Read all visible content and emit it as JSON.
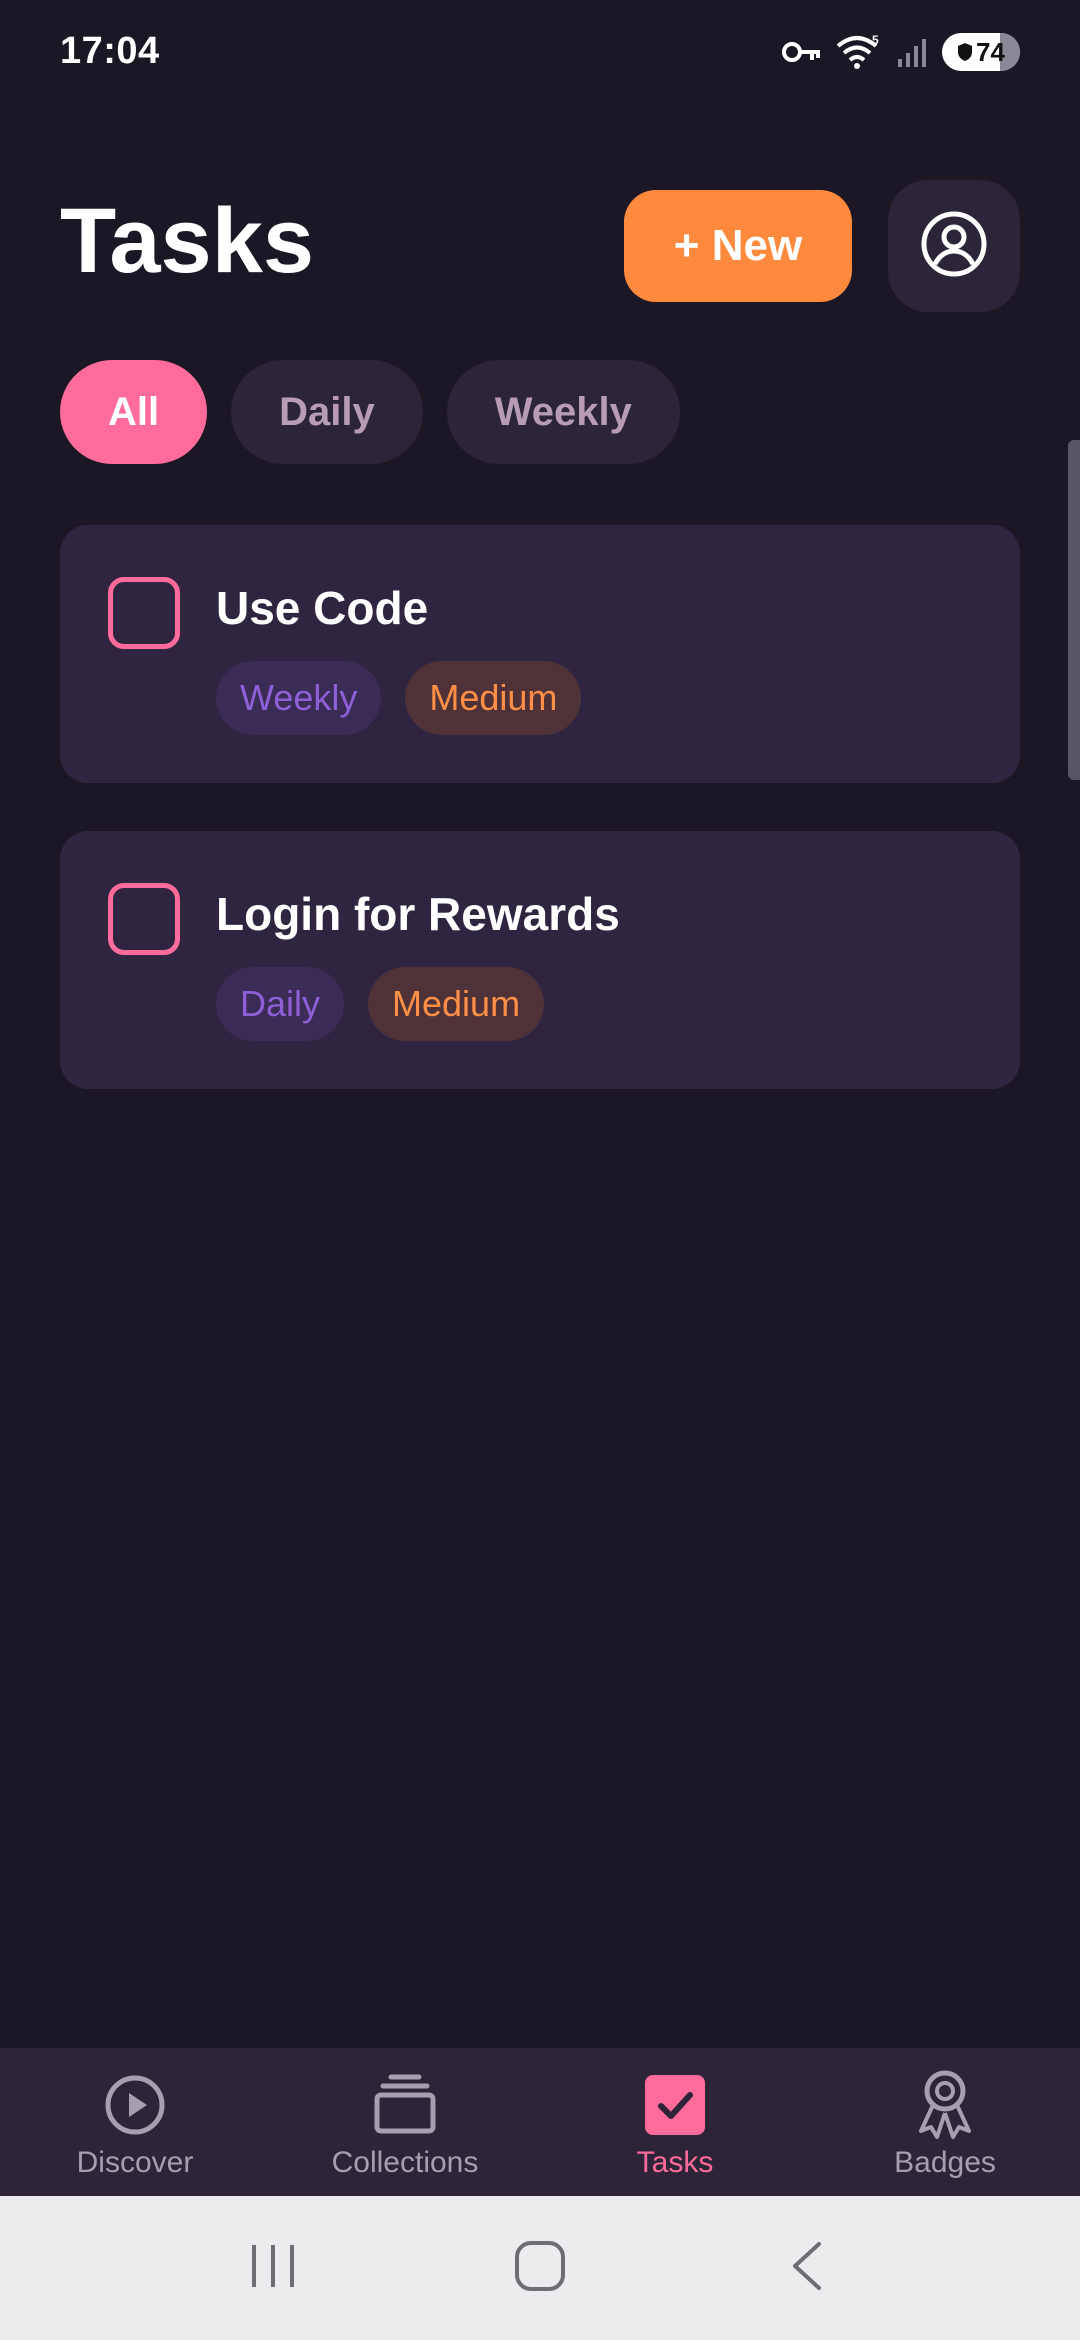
{
  "status_bar": {
    "time": "17:04",
    "battery": "74",
    "icons": [
      "vpn-key-icon",
      "wifi-icon",
      "signal-icon",
      "battery-icon"
    ]
  },
  "header": {
    "title": "Tasks",
    "new_button_label": "+ New",
    "profile_icon": "account-circle-icon"
  },
  "filters": [
    {
      "label": "All",
      "active": true
    },
    {
      "label": "Daily",
      "active": false
    },
    {
      "label": "Weekly",
      "active": false
    }
  ],
  "tasks": [
    {
      "title": "Use Code",
      "frequency": "Weekly",
      "difficulty": "Medium",
      "checked": false
    },
    {
      "title": "Login for Rewards",
      "frequency": "Daily",
      "difficulty": "Medium",
      "checked": false
    }
  ],
  "bottom_nav": [
    {
      "label": "Discover",
      "icon": "play-circle-icon",
      "active": false
    },
    {
      "label": "Collections",
      "icon": "collections-icon",
      "active": false
    },
    {
      "label": "Tasks",
      "icon": "checkbox-icon",
      "active": true
    },
    {
      "label": "Badges",
      "icon": "badge-icon",
      "active": false
    }
  ],
  "system_nav": [
    "recents-icon",
    "home-icon",
    "back-icon"
  ],
  "colors": {
    "background": "#1b1725",
    "card": "#2f2540",
    "accent_pink": "#ff6b9b",
    "accent_orange": "#ff8a3d",
    "tag_purple": "#8e5fd6",
    "tag_orange": "#ff8f47"
  }
}
